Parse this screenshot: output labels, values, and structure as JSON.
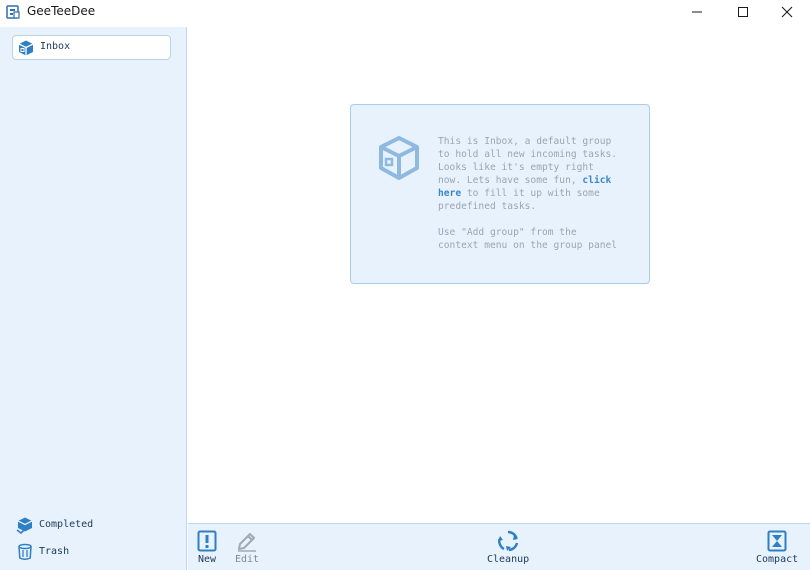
{
  "window": {
    "title": "GeeTeeDee"
  },
  "sidebar": {
    "groups": [
      {
        "label": "Inbox",
        "icon": "box-icon"
      }
    ],
    "bottom_items": [
      {
        "label": "Completed",
        "icon": "completed-icon"
      },
      {
        "label": "Trash",
        "icon": "trash-icon"
      }
    ]
  },
  "empty_state": {
    "text_before_link": "This is Inbox, a default group\nto hold all new incoming tasks.\nLooks like it's empty right\nnow. Lets have some fun, ",
    "link_text": "click\nhere",
    "text_after_link": " to fill it up with some\npredefined tasks.",
    "hint": "Use \"Add group\" from the\ncontext menu on the group panel"
  },
  "toolbar": {
    "new_label": "New",
    "edit_label": "Edit",
    "cleanup_label": "Cleanup",
    "compact_label": "Compact"
  },
  "colors": {
    "accent": "#2f7fc4",
    "panel_bg": "#e8f2fc",
    "icon_light": "#8fb9df"
  }
}
